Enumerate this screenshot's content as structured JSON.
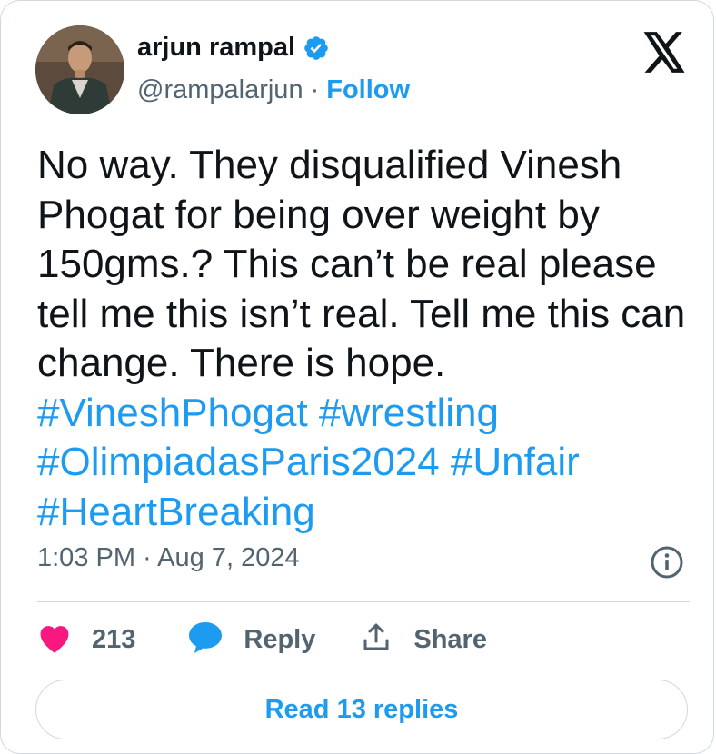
{
  "author": {
    "name": "arjun rampal",
    "handle": "@rampalarjun",
    "separator": "·",
    "follow_label": "Follow"
  },
  "tweet": {
    "segments": [
      {
        "text": "No way. They disqualified Vinesh Phogat for being over weight by 150gms.? This can’t be real please tell me this isn’t real. Tell me this can change. There is hope. ",
        "hashtag": false
      },
      {
        "text": "#VineshPhogat",
        "hashtag": true
      },
      {
        "text": " ",
        "hashtag": false
      },
      {
        "text": "#wrestling",
        "hashtag": true
      },
      {
        "text": " ",
        "hashtag": false
      },
      {
        "text": "#OlimpiadasParis2024",
        "hashtag": true
      },
      {
        "text": " ",
        "hashtag": false
      },
      {
        "text": "#Unfair",
        "hashtag": true
      },
      {
        "text": " ",
        "hashtag": false
      },
      {
        "text": "#HeartBreaking",
        "hashtag": true
      }
    ],
    "timestamp": "1:03 PM · Aug 7, 2024"
  },
  "actions": {
    "likes": "213",
    "reply_label": "Reply",
    "share_label": "Share"
  },
  "read_replies_label": "Read 13 replies",
  "icons": {
    "verified": "verified-badge-icon",
    "logo": "x-logo-icon",
    "info": "info-icon",
    "like": "heart-icon",
    "reply": "speech-bubble-icon",
    "share": "share-icon"
  },
  "colors": {
    "accent": "#1d9bf0",
    "like": "#f91880",
    "text": "#0f1419",
    "muted": "#536471",
    "border": "#cfd9de"
  }
}
